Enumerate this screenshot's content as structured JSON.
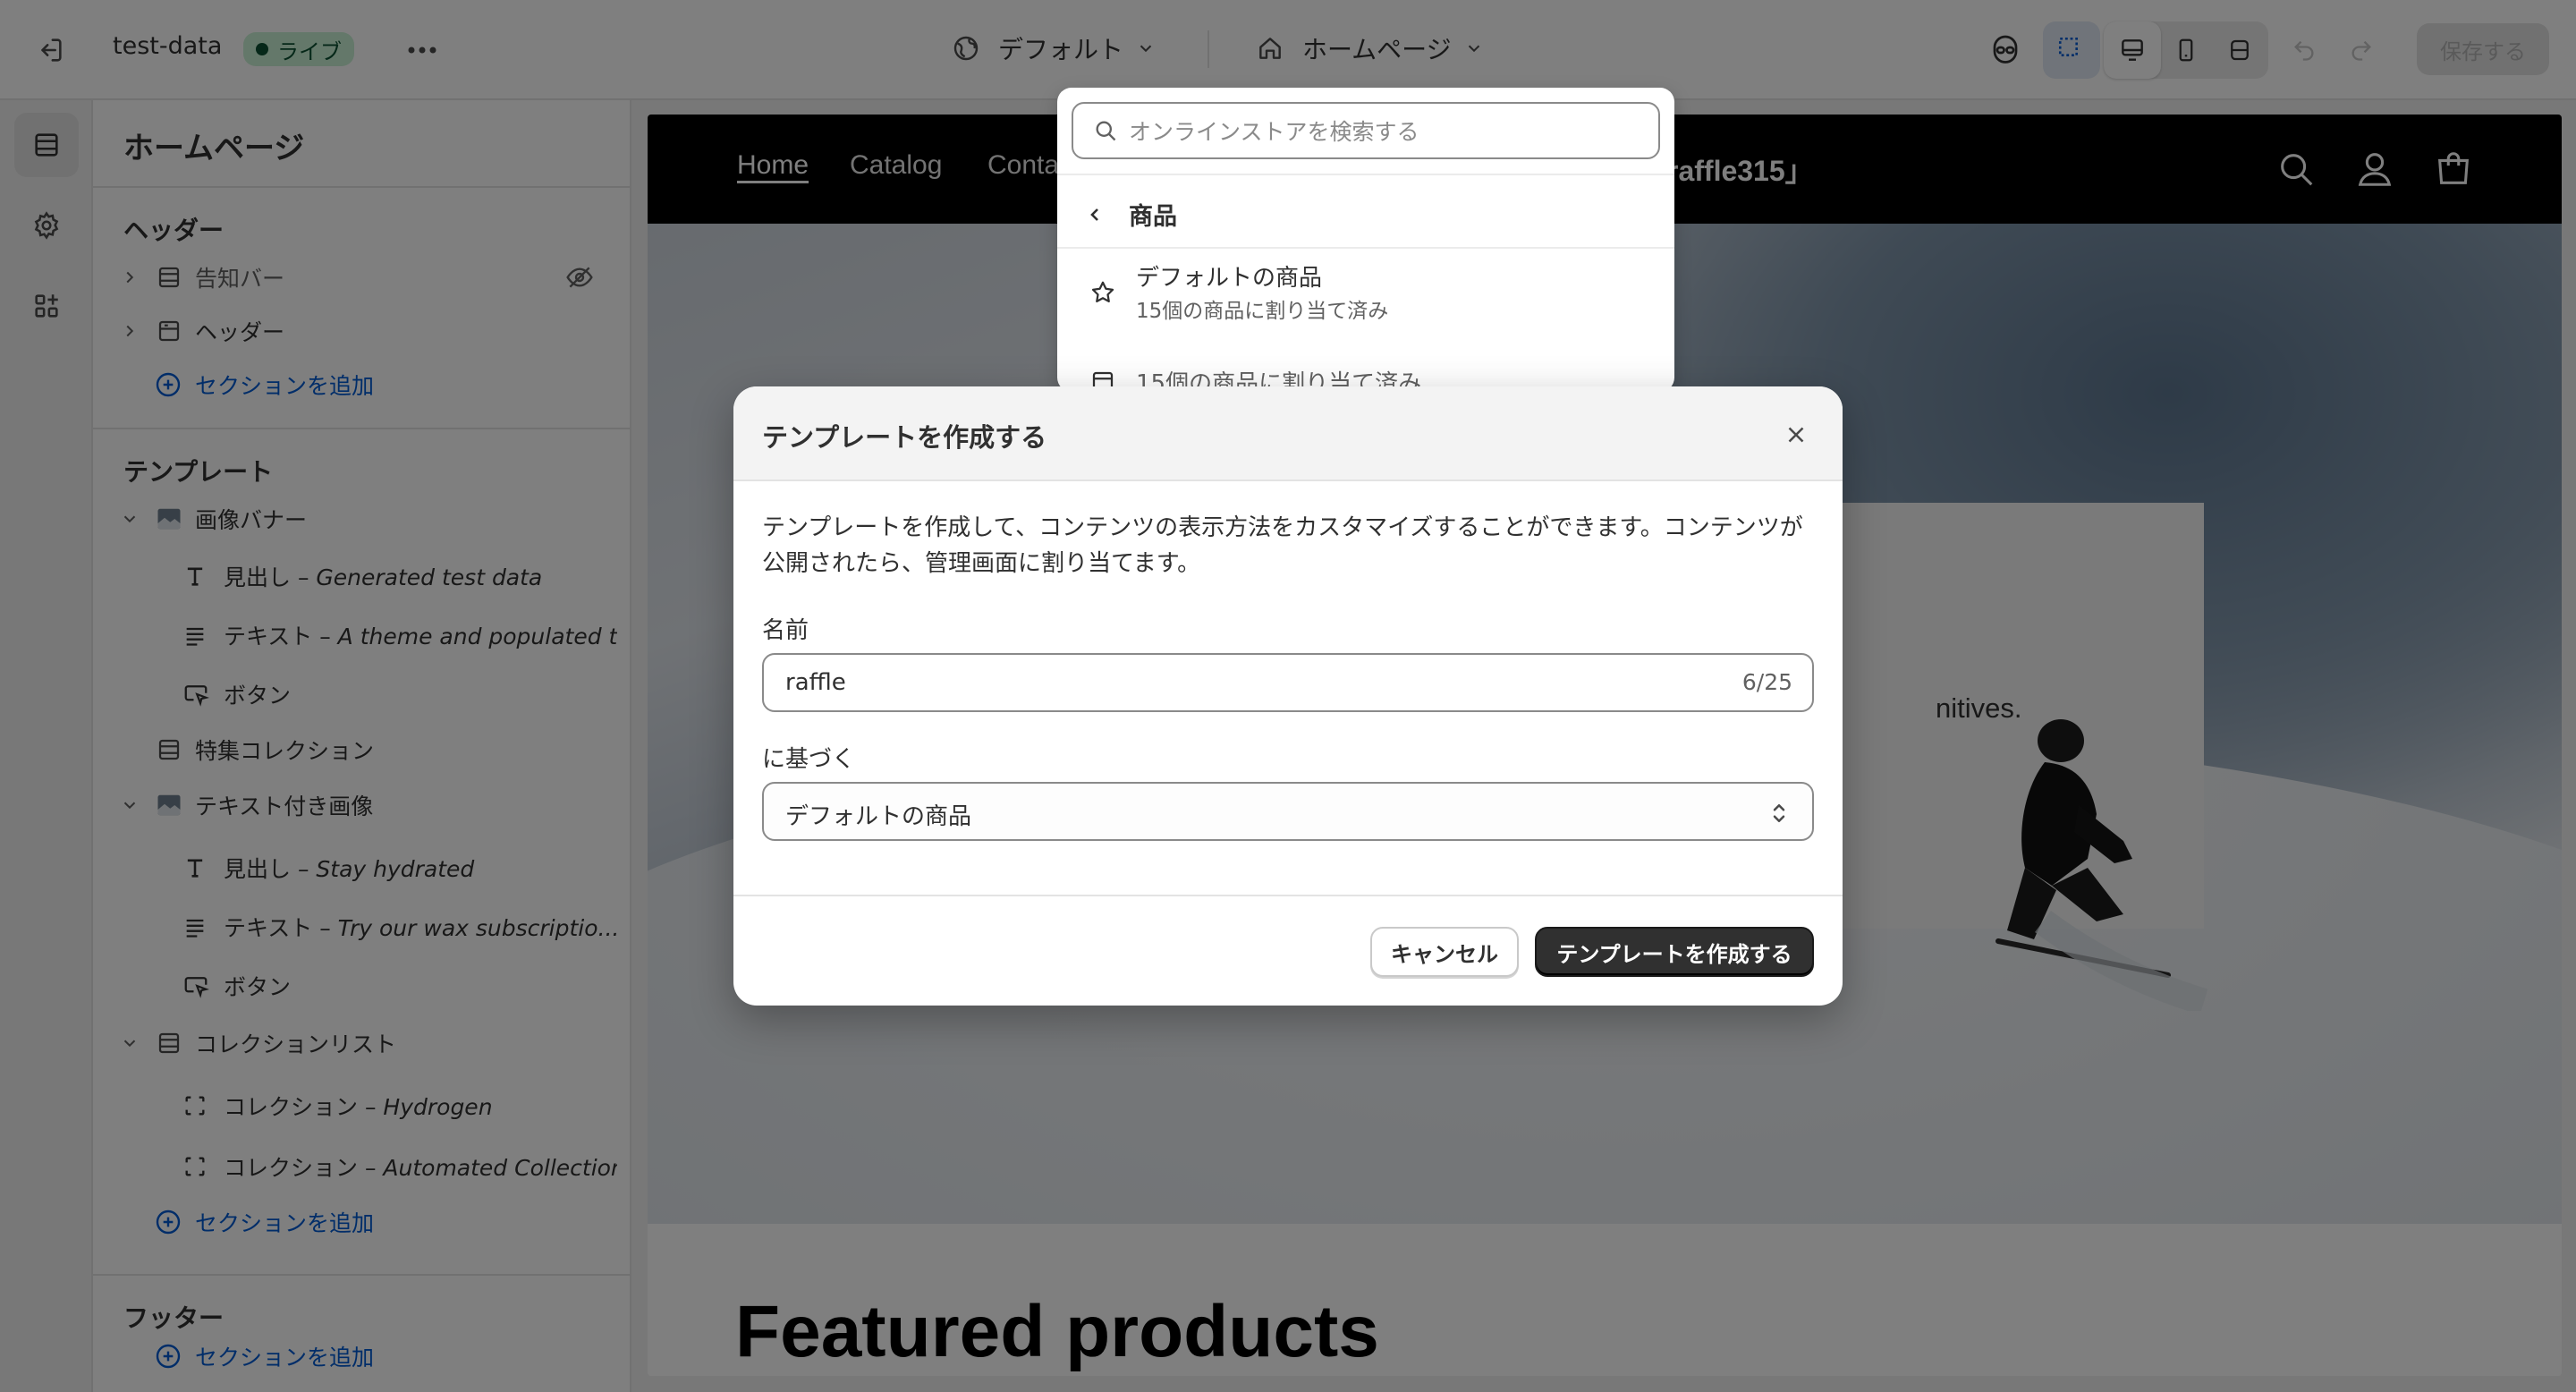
{
  "topbar": {
    "store_name": "test-data",
    "live_badge": "ライブ",
    "theme_selector": "デフォルト",
    "page_selector": "ホームページ",
    "save_label": "保存する"
  },
  "sidebar": {
    "title": "ホームページ",
    "header_section": {
      "heading": "ヘッダー",
      "items": [
        {
          "label": "告知バー"
        },
        {
          "label": "ヘッダー"
        }
      ],
      "add_label": "セクションを追加"
    },
    "template_section": {
      "heading": "テンプレート",
      "image_banner": "画像バナー",
      "heading_1_prefix": "見出し – ",
      "heading_1_value": "Generated test data",
      "text_1_prefix": "テキスト – ",
      "text_1_value": "A theme and populated t...",
      "button_1": "ボタン",
      "featured_collection": "特集コレクション",
      "image_with_text": "テキスト付き画像",
      "heading_2_prefix": "見出し – ",
      "heading_2_value": "Stay hydrated",
      "text_2_prefix": "テキスト – ",
      "text_2_value": "Try our wax subscriptio...",
      "button_2": "ボタン",
      "collection_list": "コレクションリスト",
      "collection_1_prefix": "コレクション – ",
      "collection_1_value": "Hydrogen",
      "collection_2_prefix": "コレクション – ",
      "collection_2_value": "Automated Collection",
      "add_label": "セクションを追加"
    },
    "footer_section": {
      "heading": "フッター",
      "add_label": "セクションを追加"
    }
  },
  "preview": {
    "nav": [
      "Home",
      "Catalog",
      "Conta"
    ],
    "announcement_fragment": "raffle315」",
    "hero_text_fragment": "nitives.",
    "featured_title": "Featured products"
  },
  "template_dropdown": {
    "search_placeholder": "オンラインストアを検索する",
    "back_label": "商品",
    "items": [
      {
        "title": "デフォルトの商品",
        "subtitle": "15個の商品に割り当て済み"
      },
      {
        "title": "15個の商品に割り当て済み"
      }
    ]
  },
  "modal": {
    "title": "テンプレートを作成する",
    "description": "テンプレートを作成して、コンテンツの表示方法をカスタマイズすることができます。コンテンツが公開されたら、管理画面に割り当てます。",
    "name_label": "名前",
    "name_value": "raffle",
    "char_count": "6/25",
    "based_on_label": "に基づく",
    "based_on_value": "デフォルトの商品",
    "cancel_label": "キャンセル",
    "create_label": "テンプレートを作成する"
  },
  "colors": {
    "accent_link": "#005bd3",
    "live_badge_bg": "#c9f0d4",
    "primary_button": "#303030"
  }
}
